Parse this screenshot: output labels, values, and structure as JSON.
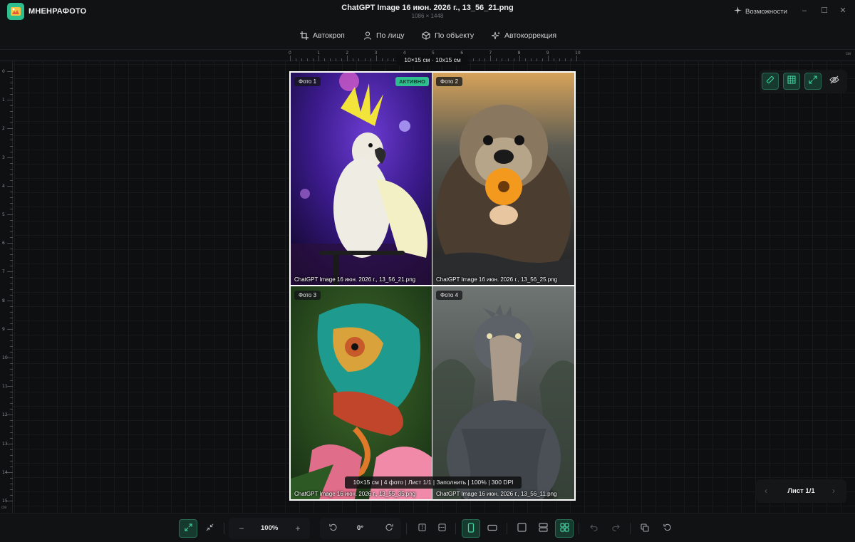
{
  "app": {
    "name": "МНЕНРАФОТО",
    "window_title": "ChatGPT Image 16 июн. 2026 г., 13_56_21.png",
    "image_dims": "1086 × 1448",
    "features_label": "Возможности"
  },
  "toolbar": {
    "tools": [
      {
        "label": "Автокроп",
        "icon": "crop-icon"
      },
      {
        "label": "По лицу",
        "icon": "person-icon"
      },
      {
        "label": "По объекту",
        "icon": "cube-icon"
      },
      {
        "label": "Автокоррекция",
        "icon": "sparkle-icon"
      }
    ]
  },
  "rulers": {
    "unit": "см",
    "top_ticks": [
      "0",
      "1",
      "2",
      "3",
      "4",
      "5",
      "6",
      "7",
      "8",
      "9",
      "10"
    ],
    "left_ticks": [
      "0",
      "1",
      "2",
      "3",
      "4",
      "5",
      "6",
      "7",
      "8",
      "9",
      "10",
      "11",
      "12",
      "13",
      "14",
      "15"
    ]
  },
  "canvas": {
    "size_label": "10×15 см · 10x15 см",
    "sheet_info": "10×15 см | 4 фото | Лист 1/1 | Заполнить | 100% | 300 DPI"
  },
  "photos": [
    {
      "tag": "Фото 1",
      "file": "ChatGPT Image 16 июн. 2026 г., 13_56_21.png",
      "active": true
    },
    {
      "tag": "Фото 2",
      "file": "ChatGPT Image 16 июн. 2026 г., 13_56_25.png",
      "active": false
    },
    {
      "tag": "Фото 3",
      "file": "ChatGPT Image 16 июн. 2026 г., 13_55_35.png",
      "active": false
    },
    {
      "tag": "Фото 4",
      "file": "ChatGPT Image 16 июн. 2026 г., 13_56_11.png",
      "active": false
    }
  ],
  "active_badge": "АКТИВНО",
  "sheet_nav": {
    "label": "Лист 1/1"
  },
  "bottom": {
    "zoom": "100%",
    "rotation": "0°",
    "zoom_minus": "−",
    "zoom_plus": "+"
  },
  "colors": {
    "accent": "#2fbf8f",
    "background": "#0d0e0f"
  }
}
